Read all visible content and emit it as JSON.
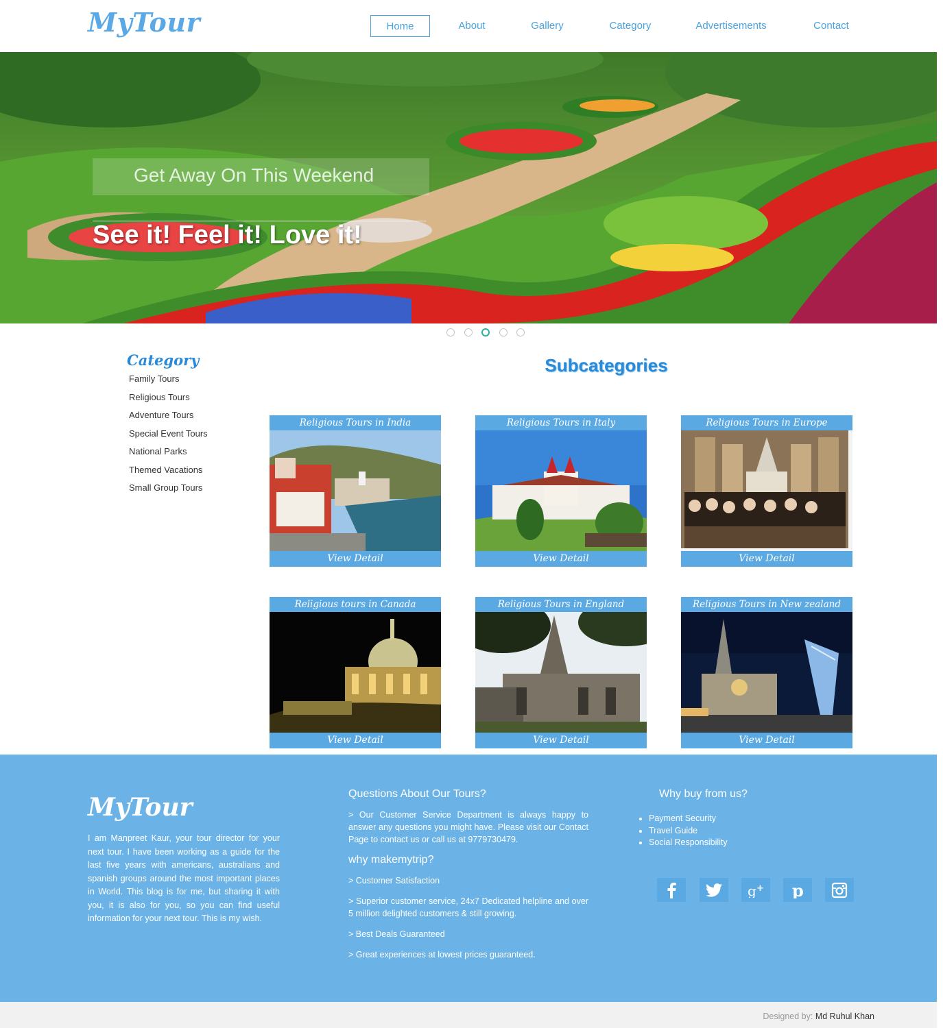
{
  "header": {
    "logo": "MyTour",
    "nav": [
      {
        "label": "Home",
        "active": true
      },
      {
        "label": "About"
      },
      {
        "label": "Gallery"
      },
      {
        "label": "Category"
      },
      {
        "label": "Advertisements"
      },
      {
        "label": "Contact"
      }
    ]
  },
  "hero": {
    "subtitle": "Get Away On This Weekend",
    "title": "See it! Feel it! Love it!",
    "slide_count": 5,
    "active_slide": 3
  },
  "sidebar": {
    "title": "Category",
    "items": [
      "Family Tours",
      "Religious Tours",
      "Adventure Tours",
      "Special Event Tours",
      "National Parks",
      "Themed Vacations",
      "Small Group Tours"
    ]
  },
  "main": {
    "title": "Subcategories",
    "cards": [
      {
        "title": "Religious Tours in India",
        "button": "View Detail"
      },
      {
        "title": "Religious Tours in Italy",
        "button": "View Detail"
      },
      {
        "title": "Religious Tours in Europe",
        "button": "View Detail"
      },
      {
        "title": "Religious tours in Canada",
        "button": "View Detail"
      },
      {
        "title": "Religious Tours in England",
        "button": "View Detail"
      },
      {
        "title": "Religious Tours in New zealand",
        "button": "View Detail"
      }
    ]
  },
  "footer": {
    "logo": "MyTour",
    "about": "I am Manpreet Kaur, your tour director for your next tour. I have been working as a guide for the last five years with americans, australians and spanish groups around the most important places in World. This blog is for me, but sharing it with you, it is also for you, so you can find useful information for your next tour. This is my wish.",
    "questions_title": "Questions About Our Tours?",
    "questions_text": ">   Our Customer Service Department is always happy to answer any questions you might have. Please visit our Contact Page to contact us or call us at 9779730479.",
    "why_title": "why makemytrip?",
    "why_items": [
      ">   Customer Satisfaction",
      ">   Superior customer service, 24x7 Dedicated helpline and over 5 million delighted customers & still growing.",
      ">   Best Deals Guaranteed",
      ">   Great experiences at lowest prices guaranteed."
    ],
    "buy_title": "Why buy from us?",
    "buy_items": [
      "Payment Security",
      "Travel Guide",
      "Social Responsibility"
    ],
    "social": [
      "facebook-icon",
      "twitter-icon",
      "google-plus-icon",
      "pinterest-icon",
      "instagram-icon"
    ],
    "credit_label": "Designed by:",
    "credit_name": "Md Ruhul Khan"
  },
  "colors": {
    "accent": "#4aa3df",
    "card_blue": "#5ba9e2",
    "footer_blue": "#6bb3e6",
    "title_blue": "#2a8ad8"
  }
}
